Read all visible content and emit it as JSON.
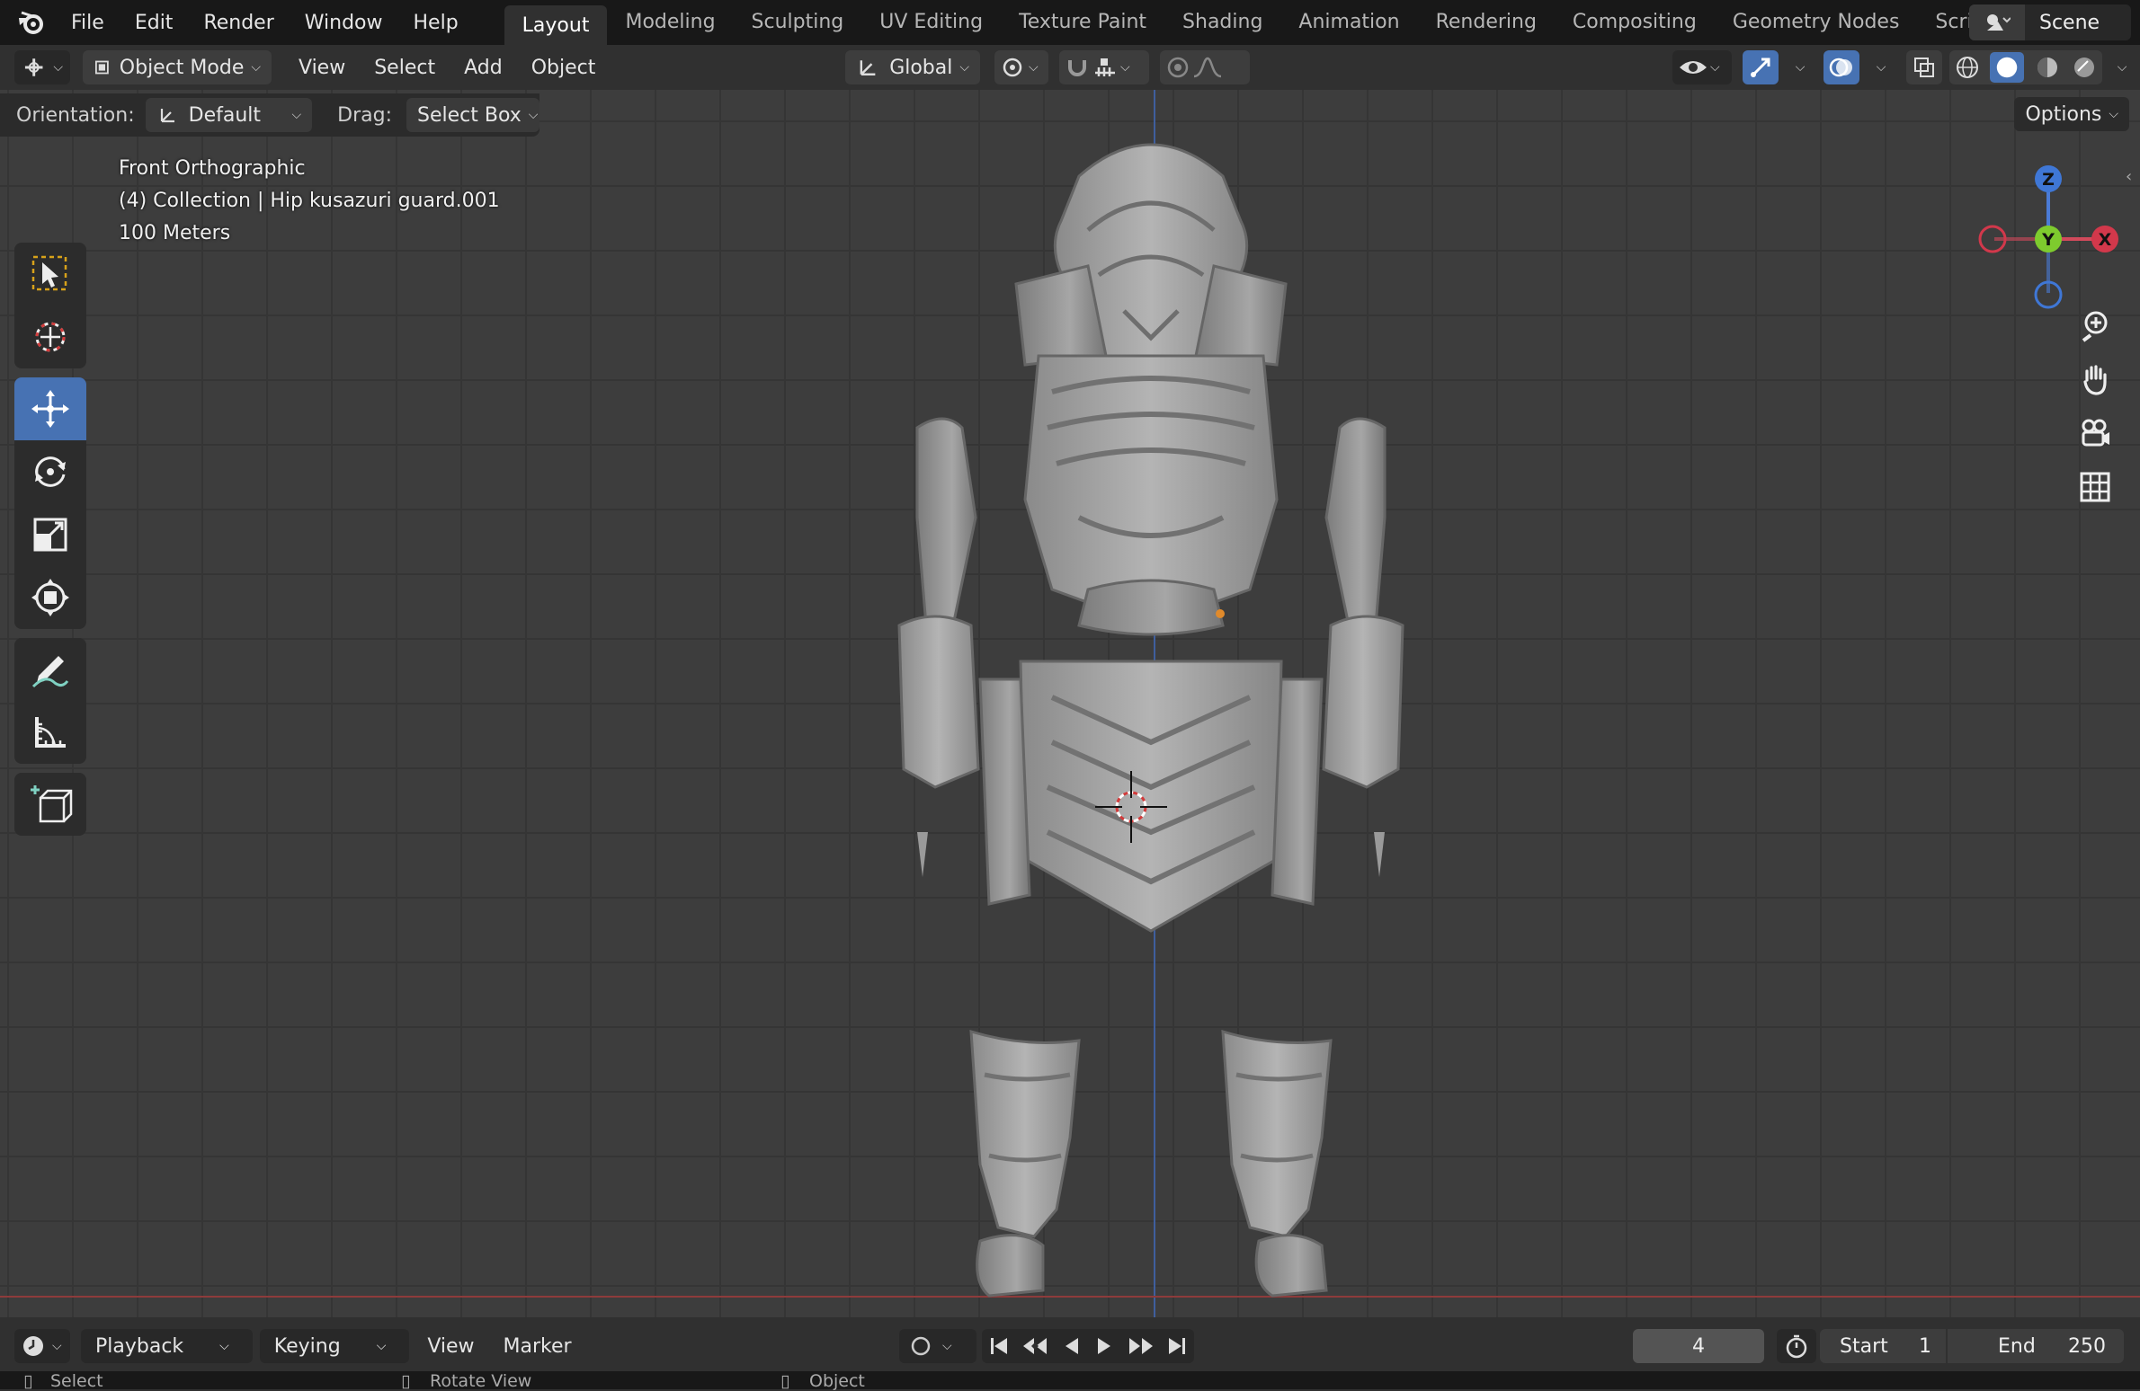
{
  "topbar": {
    "menus": [
      "File",
      "Edit",
      "Render",
      "Window",
      "Help"
    ],
    "workspaces": [
      "Layout",
      "Modeling",
      "Sculpting",
      "UV Editing",
      "Texture Paint",
      "Shading",
      "Animation",
      "Rendering",
      "Compositing",
      "Geometry Nodes",
      "Scripting"
    ],
    "active_workspace": "Layout",
    "scene_label": "Scene"
  },
  "header": {
    "mode": "Object Mode",
    "menus": [
      "View",
      "Select",
      "Add",
      "Object"
    ],
    "transform_orientation": "Global"
  },
  "tool_settings": {
    "orientation_label": "Orientation:",
    "orientation_value": "Default",
    "drag_label": "Drag:",
    "drag_value": "Select Box",
    "options_label": "Options"
  },
  "viewport": {
    "view_name": "Front Orthographic",
    "collection_info": "(4) Collection | Hip kusazuri guard.001",
    "scale_info": "100 Meters",
    "gizmo": {
      "z": "Z",
      "y": "Y",
      "x": "X"
    },
    "colors": {
      "grid_bg": "#3d3d3d",
      "z_axis": "#3f5f9e",
      "x_axis": "#8e3b3b",
      "active_tool": "#4772b3"
    }
  },
  "timeline": {
    "menus": [
      "Playback",
      "Keying",
      "View",
      "Marker"
    ],
    "current_frame": "4",
    "start_label": "Start",
    "start_value": "1",
    "end_label": "End",
    "end_value": "250"
  },
  "statusbar": {
    "items": [
      "Select",
      "Rotate View",
      "Object"
    ]
  }
}
